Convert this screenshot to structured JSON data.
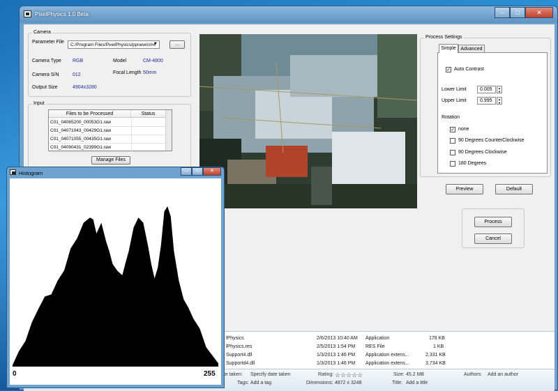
{
  "main_window": {
    "title": "PixelPhysics 1.0 Beta"
  },
  "camera": {
    "legend": "Camera",
    "parameter_file_label": "Parameter File",
    "parameter_file_value": "C:/Program Files/PixelPhysics/ppnew/cm4",
    "browse_label": "...",
    "camera_type_label": "Camera Type",
    "camera_type": "RGB",
    "model_label": "Model",
    "model": "CM-4800",
    "sn_label": "Camera S/N",
    "sn": "012",
    "focal_label": "Focal Length",
    "focal": "50mm",
    "output_label": "Output Size",
    "output": "4904x3280"
  },
  "input": {
    "legend": "Input",
    "col_files": "Files to be Processed",
    "col_status": "Status",
    "files": [
      "C01_04065200_00053G1.raw",
      "C01_04071043_00429G1.raw",
      "C01_04071055_00435G1.raw",
      "C01_04090431_02399G1.raw"
    ],
    "manage_label": "Manage Files"
  },
  "process_settings": {
    "legend": "Process Settings",
    "tab_simple": "Simple",
    "tab_advanced": "Advanced",
    "auto_contrast": "Auto Contrast",
    "lower_label": "Lower Limit",
    "lower_value": "0.005",
    "upper_label": "Upper Limit",
    "upper_value": "0.995",
    "rotation_label": "Rotation",
    "rotation_options": [
      "none",
      "90 Degrees CounterClockwise",
      "90 Degrees Clockwise",
      "180 Degrees"
    ],
    "preview_label": "Preview",
    "default_label": "Default",
    "process_label": "Process",
    "cancel_label": "Cancel"
  },
  "explorer": {
    "files": [
      {
        "name": "lPhysics",
        "date": "2/6/2013 10:40 AM",
        "type": "Application",
        "size": "178 KB"
      },
      {
        "name": "lPhysics.res",
        "date": "2/5/2013 1:54 PM",
        "type": "RES File",
        "size": "1 KB"
      },
      {
        "name": "Support4.dll",
        "date": "1/3/2013 1:46 PM",
        "type": "Application extens...",
        "size": "2,331 KB"
      },
      {
        "name": "Supportd4.dll",
        "date": "1/3/2013 1:46 PM",
        "type": "Application extens...",
        "size": "3,734 KB"
      }
    ],
    "details": {
      "date_taken_label": "Date taken:",
      "date_taken": "Specify date taken",
      "tags_label": "Tags:",
      "tags": "Add a tag",
      "rating_label": "Rating:",
      "rating_stars": "☆☆☆☆☆",
      "dimensions_label": "Dimensions:",
      "dimensions": "4872 x 3248",
      "size_label": "Size:",
      "size": "45.2 MB",
      "title_label": "Title:",
      "title": "Add a title",
      "authors_label": "Authors:",
      "authors": "Add an author"
    }
  },
  "histogram": {
    "title": "Histogram",
    "x_min_label": "0",
    "x_max_label": "255"
  },
  "chart_data": {
    "type": "area",
    "title": "Histogram",
    "xlabel": "",
    "ylabel": "",
    "xlim": [
      0,
      255
    ],
    "ylim": [
      0,
      1
    ],
    "x": [
      0,
      8,
      16,
      24,
      32,
      40,
      48,
      56,
      64,
      72,
      80,
      88,
      96,
      100,
      104,
      110,
      116,
      120,
      124,
      130,
      136,
      140,
      144,
      150,
      156,
      162,
      168,
      172,
      176,
      180,
      184,
      188,
      192,
      196,
      200,
      206,
      212,
      218,
      224,
      232,
      240,
      248,
      255
    ],
    "values": [
      0.01,
      0.08,
      0.16,
      0.26,
      0.36,
      0.42,
      0.45,
      0.52,
      0.6,
      0.72,
      0.8,
      0.88,
      0.93,
      0.9,
      0.83,
      0.88,
      0.78,
      0.7,
      0.64,
      0.58,
      0.57,
      0.63,
      0.72,
      0.85,
      0.93,
      0.88,
      0.75,
      0.62,
      0.55,
      0.6,
      0.76,
      0.95,
      1.0,
      0.92,
      0.72,
      0.52,
      0.42,
      0.35,
      0.3,
      0.22,
      0.12,
      0.05,
      0.02
    ],
    "colors": {
      "fill": "#000000"
    }
  }
}
